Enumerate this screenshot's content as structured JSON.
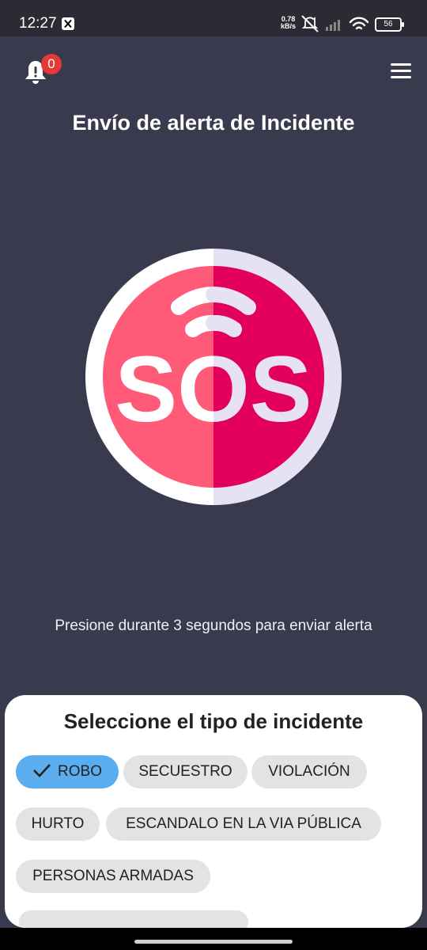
{
  "status_bar": {
    "time": "12:27",
    "speed_value": "0.78",
    "speed_unit": "kB/s",
    "battery": "56"
  },
  "header": {
    "notification_count": "0",
    "title": "Envío de alerta de Incidente"
  },
  "sos_button": {
    "label": "SOS",
    "hint": "Presione durante 3 segundos para enviar alerta"
  },
  "incident_sheet": {
    "title": "Seleccione el tipo de incidente",
    "chips": [
      {
        "label": "ROBO",
        "selected": true
      },
      {
        "label": "SECUESTRO",
        "selected": false
      },
      {
        "label": "VIOLACIÓN",
        "selected": false
      },
      {
        "label": "HURTO",
        "selected": false
      },
      {
        "label": "ESCANDALO EN LA VIA PÚBLICA",
        "selected": false
      },
      {
        "label": "PERSONAS ARMADAS",
        "selected": false
      }
    ]
  },
  "colors": {
    "background": "#3a3a4f",
    "sos_left": "#ff5a78",
    "sos_right": "#e2005a",
    "selected_chip": "#5aaef0",
    "badge": "#e53935"
  }
}
